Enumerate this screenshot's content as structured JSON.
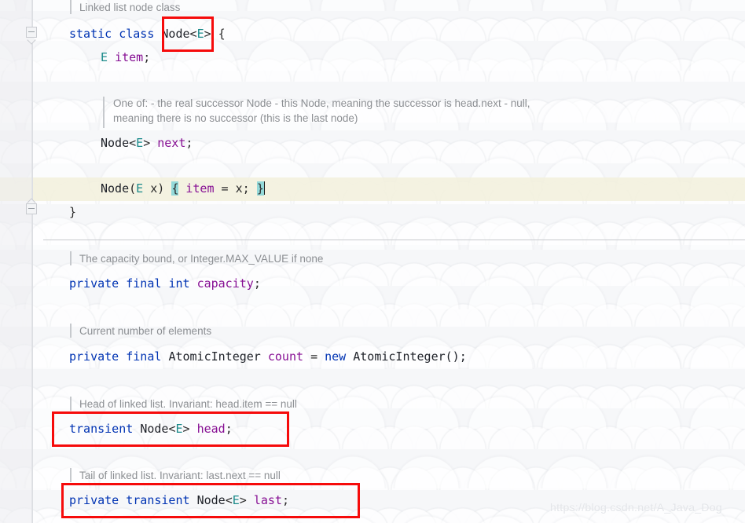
{
  "app": {
    "kind": "code-editor",
    "language": "Java",
    "theme": "IntelliJ Light"
  },
  "gutter": {
    "fold_markers": [
      {
        "name": "fold-start",
        "state": "expanded",
        "glyph": "minus-down"
      },
      {
        "name": "fold-end",
        "state": "expanded",
        "glyph": "minus-up"
      }
    ]
  },
  "doc_comments": [
    {
      "id": "doc-node-class",
      "text": "Linked list node class"
    },
    {
      "id": "doc-next-field-l1",
      "text": "One of: - the real successor Node - this Node, meaning the successor is head.next - null,"
    },
    {
      "id": "doc-next-field-l2",
      "text": "meaning there is no successor (this is the last node)"
    },
    {
      "id": "doc-capacity",
      "text": "The capacity bound, or Integer.MAX_VALUE if none"
    },
    {
      "id": "doc-count",
      "text": "Current number of elements"
    },
    {
      "id": "doc-head",
      "text": "Head of linked list. Invariant: head.item == null"
    },
    {
      "id": "doc-last",
      "text": "Tail of linked list. Invariant: last.next == null"
    }
  ],
  "code_lines": {
    "class_decl": {
      "kw_static": "static",
      "kw_class": "class",
      "type_node": "Node",
      "lt": "<",
      "generic_e": "E",
      "gt": ">",
      "open_brace": "{"
    },
    "item_field": {
      "generic_e": "E",
      "name": "item",
      "semi": ";"
    },
    "next_field": {
      "type_node": "Node",
      "lt": "<",
      "generic_e": "E",
      "gt": ">",
      "name": "next",
      "semi": ";"
    },
    "ctor": {
      "type_node": "Node",
      "paren_open": "(",
      "generic_e": "E",
      "param": "x",
      "paren_close": ")",
      "brace_open": "{",
      "field_item": "item",
      "assign": "=",
      "value_x": "x",
      "semi": ";",
      "brace_close": "}"
    },
    "class_close": {
      "brace": "}"
    },
    "capacity_field": {
      "kw_private": "private",
      "kw_final": "final",
      "kw_int": "int",
      "name": "capacity",
      "semi": ";"
    },
    "count_field": {
      "kw_private": "private",
      "kw_final": "final",
      "type": "AtomicInteger",
      "name": "count",
      "assign": "=",
      "kw_new": "new",
      "ctor_call": "AtomicInteger();"
    },
    "head_field": {
      "kw_transient": "transient",
      "type_node": "Node",
      "lt": "<",
      "generic_e": "E",
      "gt": ">",
      "name": "head",
      "semi": ";"
    },
    "last_field": {
      "kw_private": "private",
      "kw_transient": "transient",
      "type_node": "Node",
      "lt": "<",
      "generic_e": "E",
      "gt": ">",
      "name": "last",
      "semi": ";"
    }
  },
  "annotations": {
    "red_boxes": [
      {
        "id": "box-node-type",
        "target": "Node<E>"
      },
      {
        "id": "box-head-field",
        "target": "transient Node<E> head;"
      },
      {
        "id": "box-last-field",
        "target": "private transient Node<E> last;"
      }
    ],
    "brace_match_highlight": {
      "color": "#93d9d9",
      "chars": [
        "{",
        "}"
      ]
    },
    "caret_line_highlight": {
      "color": "#f2f0dc"
    }
  },
  "colors": {
    "keyword": "#0033b3",
    "field": "#871094",
    "generic_type": "#1a8a8a",
    "class_type": "#20232a",
    "comment": "#8c8f93",
    "annotation_red": "#f60b0b",
    "brace_highlight": "#93d9d9",
    "caret_line": "#f2f0dc"
  },
  "watermark": {
    "text": "https://blog.csdn.net/A_Java_Dog"
  }
}
